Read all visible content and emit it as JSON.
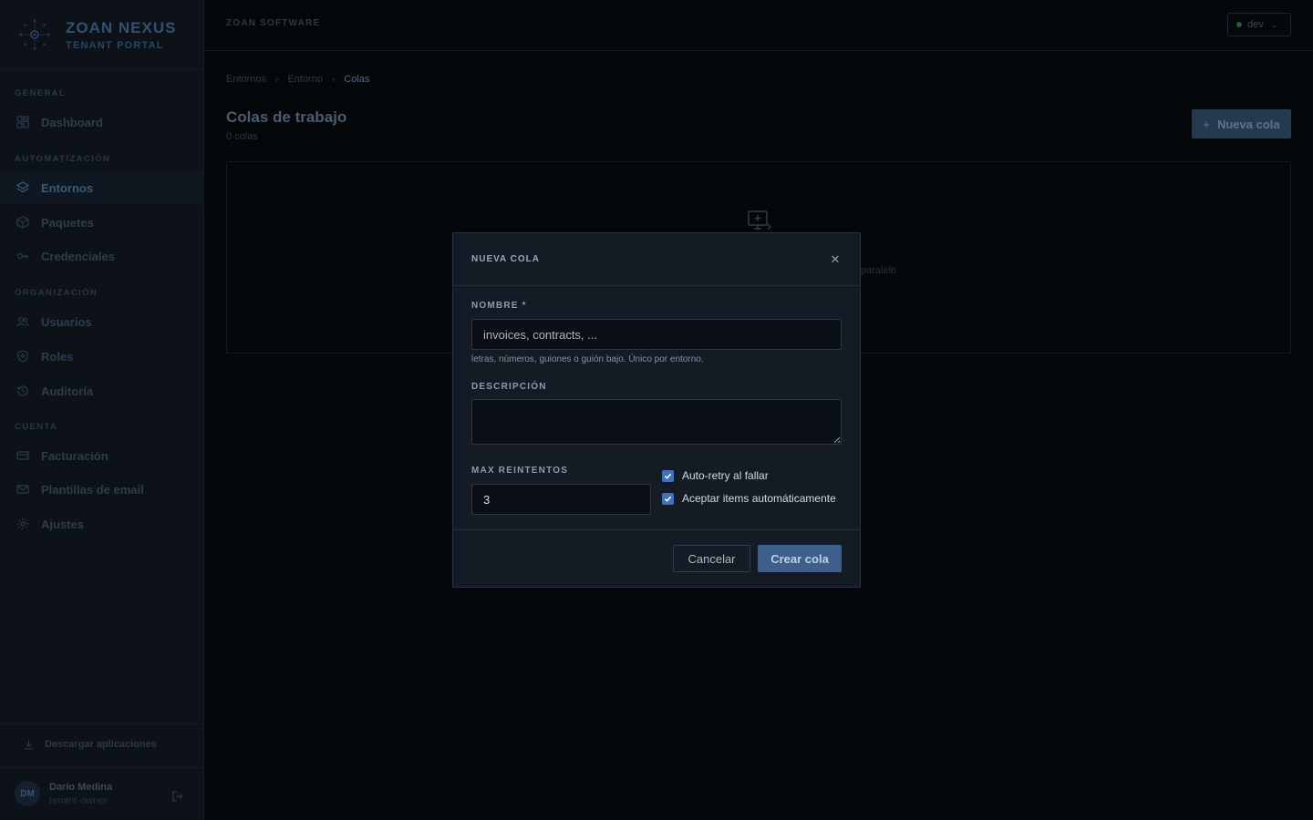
{
  "brand": {
    "title": "ZOAN NEXUS",
    "subtitle": "TENANT PORTAL"
  },
  "sidebar": {
    "sections": [
      {
        "label": "GENERAL"
      },
      {
        "label": "AUTOMATIZACIÓN"
      },
      {
        "label": "ORGANIZACIÓN"
      },
      {
        "label": "CUENTA"
      }
    ],
    "items": [
      {
        "label": "Dashboard",
        "icon": "grid-icon"
      },
      {
        "label": "Entornos",
        "icon": "layers-icon",
        "active": true
      },
      {
        "label": "Paquetes",
        "icon": "box-icon"
      },
      {
        "label": "Credenciales",
        "icon": "key-icon"
      },
      {
        "label": "Usuarios",
        "icon": "users-icon"
      },
      {
        "label": "Roles",
        "icon": "shield-icon"
      },
      {
        "label": "Auditoría",
        "icon": "history-icon"
      },
      {
        "label": "Facturación",
        "icon": "credit-card-icon"
      },
      {
        "label": "Plantillas de email",
        "icon": "mail-icon"
      },
      {
        "label": "Ajustes",
        "icon": "gear-icon"
      }
    ],
    "download_label": "Descargar aplicaciones",
    "user": {
      "initials": "DM",
      "name": "Dario Medina",
      "role": "tenant-owner"
    }
  },
  "topbar": {
    "org": "ZOAN SOFTWARE",
    "env": "dev"
  },
  "main": {
    "breadcrumb": [
      "Entornos",
      "Entorno",
      "Colas"
    ],
    "title": "Colas de trabajo",
    "count": "0 colas",
    "new_button": "Nueva cola",
    "empty_text_fragment": "paralelo"
  },
  "modal": {
    "title": "NUEVA COLA",
    "name_label": "NOMBRE *",
    "name_placeholder": "invoices, contracts, ...",
    "name_hint": "letras, números, guiones o guión bajo. Único por entorno.",
    "description_label": "DESCRIPCIÓN",
    "max_retries_label": "MAX REINTENTOS",
    "max_retries_value": "3",
    "auto_retry_label": "Auto-retry al fallar",
    "auto_retry_checked": true,
    "auto_accept_label": "Aceptar items automáticamente",
    "auto_accept_checked": true,
    "cancel_label": "Cancelar",
    "create_label": "Crear cola"
  },
  "colors": {
    "accent": "#3f72b8",
    "primary_button": "#3e5f89",
    "background": "#05080b"
  }
}
